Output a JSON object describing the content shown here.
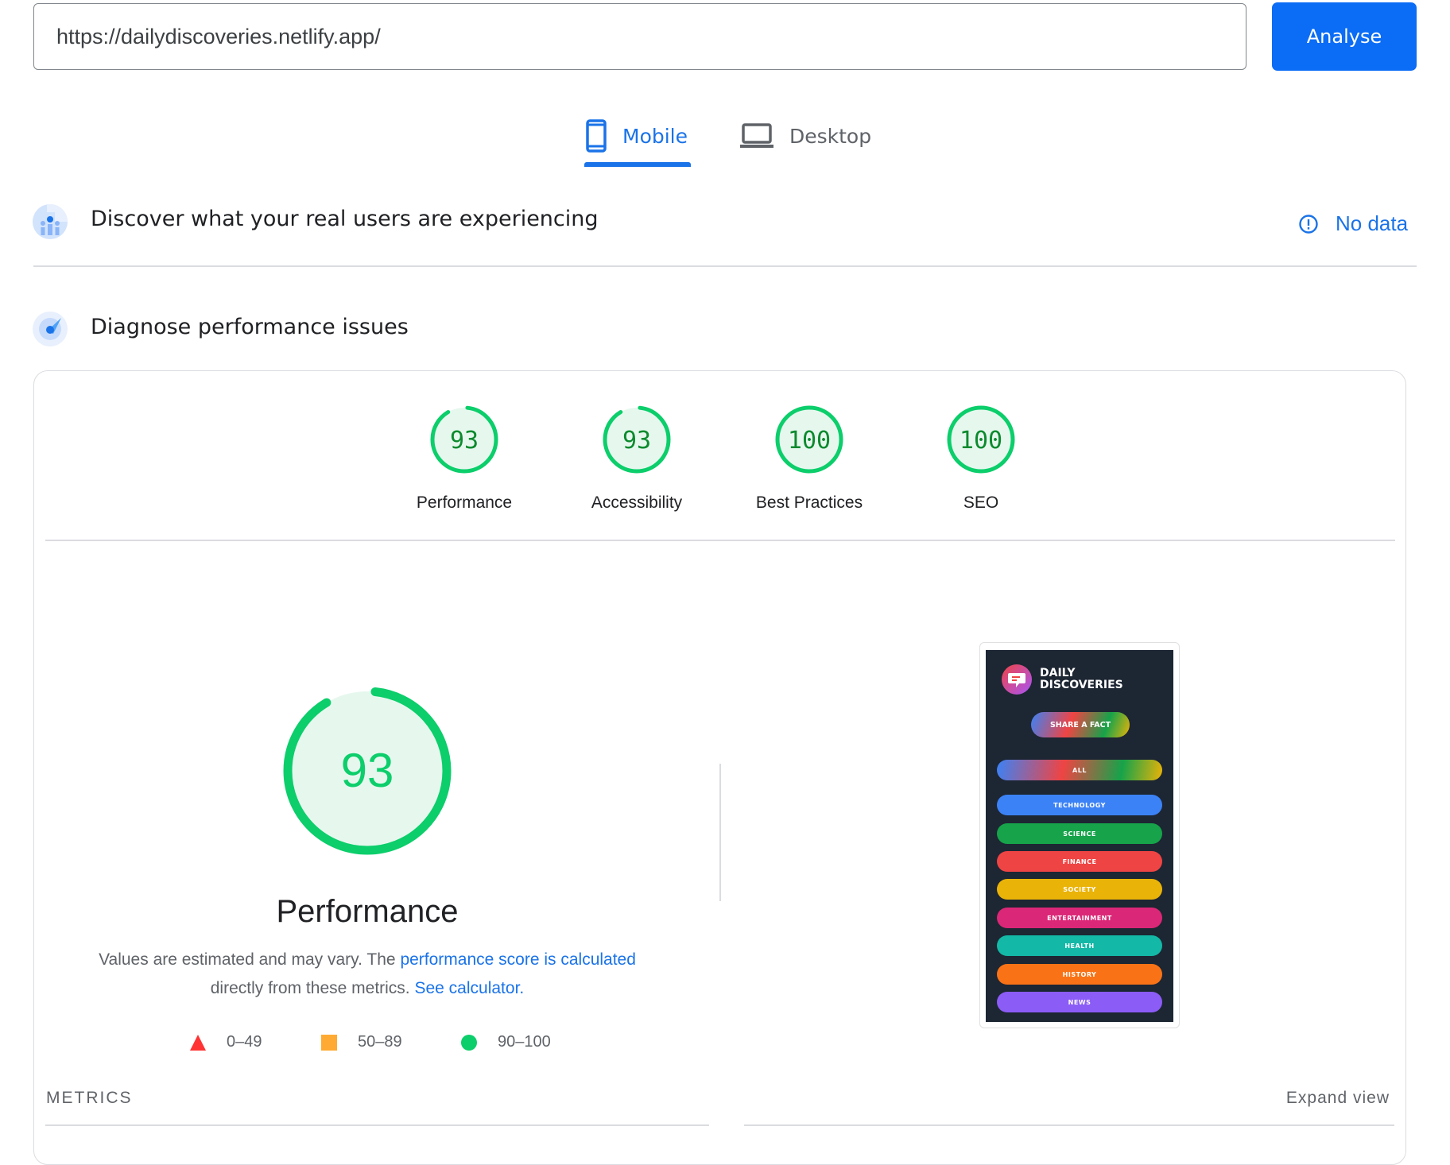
{
  "search": {
    "url_value": "https://dailydiscoveries.netlify.app/",
    "analyse_label": "Analyse"
  },
  "tabs": [
    {
      "label": "Mobile",
      "icon": "smartphone-icon",
      "active": true
    },
    {
      "label": "Desktop",
      "icon": "laptop-icon",
      "active": false
    }
  ],
  "field_data": {
    "title": "Discover what your real users are experiencing",
    "icon": "real-users-icon",
    "status_icon": "info-circle-icon",
    "status_label": "No data"
  },
  "lab_data": {
    "title": "Diagnose performance issues",
    "icon": "lighthouse-gauge-icon"
  },
  "scores": [
    {
      "label": "Performance",
      "value": 93
    },
    {
      "label": "Accessibility",
      "value": 93
    },
    {
      "label": "Best Practices",
      "value": 100
    },
    {
      "label": "SEO",
      "value": 100
    }
  ],
  "performance": {
    "score": 93,
    "title": "Performance",
    "desc_prefix": "Values are estimated and may vary. The ",
    "desc_link1": "performance score is calculated",
    "desc_middle": " directly from these metrics. ",
    "desc_link2": "See calculator."
  },
  "legend": [
    {
      "range": "0–49",
      "shape": "triangle",
      "color": "#ff3333"
    },
    {
      "range": "50–89",
      "shape": "square",
      "color": "#ffaa33"
    },
    {
      "range": "90–100",
      "shape": "circle",
      "color": "#0cce6b"
    }
  ],
  "metrics": {
    "label": "METRICS",
    "expand_label": "Expand view"
  },
  "screenshot": {
    "app_name_line1": "DAILY",
    "app_name_line2": "DISCOVERIES",
    "share_button": "SHARE A FACT",
    "categories": [
      {
        "label": "ALL",
        "color": "gradient"
      },
      {
        "label": "TECHNOLOGY",
        "color": "#3b82f6"
      },
      {
        "label": "SCIENCE",
        "color": "#16a34a"
      },
      {
        "label": "FINANCE",
        "color": "#ef4444"
      },
      {
        "label": "SOCIETY",
        "color": "#eab308"
      },
      {
        "label": "ENTERTAINMENT",
        "color": "#db2777"
      },
      {
        "label": "HEALTH",
        "color": "#14b8a6"
      },
      {
        "label": "HISTORY",
        "color": "#f97316"
      },
      {
        "label": "NEWS",
        "color": "#8b5cf6"
      }
    ]
  },
  "colors": {
    "accent": "#1a73e8",
    "button": "#0b6cf5",
    "pass": "#0cce6b",
    "pass_text": "#0d8a2e",
    "pass_bg": "#e6f8ee"
  }
}
